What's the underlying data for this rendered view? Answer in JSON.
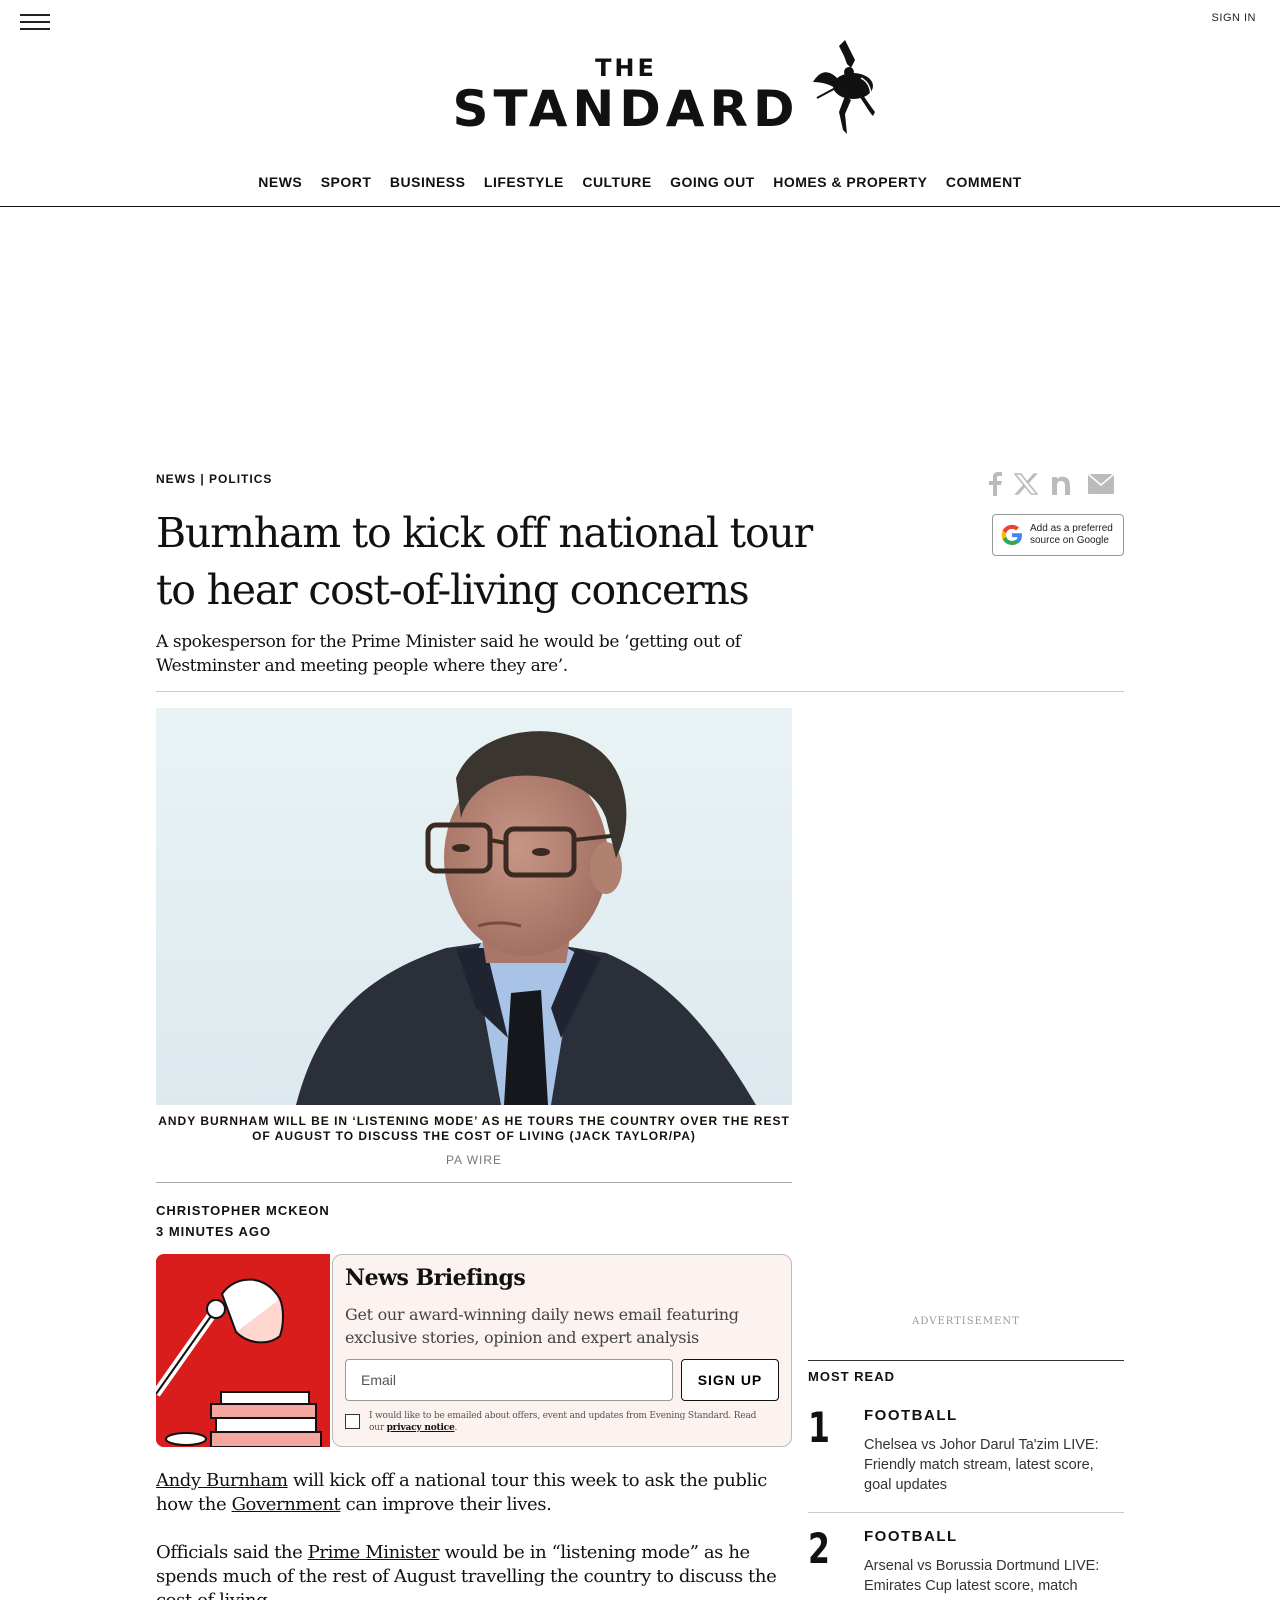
{
  "header": {
    "sign_in": "SIGN IN",
    "logo_the": "THE",
    "logo_main": "STANDARD"
  },
  "nav": [
    "NEWS",
    "SPORT",
    "BUSINESS",
    "LIFESTYLE",
    "CULTURE",
    "GOING OUT",
    "HOMES & PROPERTY",
    "COMMENT"
  ],
  "article": {
    "section": "NEWS",
    "separator": "|",
    "subsection": "POLITICS",
    "headline": "Burnham to kick off national tour to hear cost-of-living concerns",
    "standfirst": "A spokesperson for the Prime Minister said he would be ‘getting out of Westminster and meeting people where they are’.",
    "image_caption": "ANDY BURNHAM WILL BE IN ‘LISTENING MODE’ AS HE TOURS THE COUNTRY OVER THE REST OF AUGUST TO DISCUSS THE COST OF LIVING (JACK TAYLOR/PA)",
    "image_credit": "PA WIRE",
    "author": "CHRISTOPHER MCKEON",
    "published": "3 MINUTES AGO"
  },
  "share": {
    "google_preferred_line1": "Add as a preferred",
    "google_preferred_line2": "source on Google"
  },
  "newsletter": {
    "title": "News Briefings",
    "description": "Get our award-winning daily news email featuring exclusive stories, opinion and expert analysis",
    "email_placeholder": "Email",
    "signup_label": "SIGN UP",
    "consent_text": "I would like to be emailed about offers, event and updates from Evening Standard. Read our",
    "privacy_link": "privacy notice",
    "consent_end": "."
  },
  "body": {
    "p1_link1": "Andy Burnham",
    "p1_text1": " will kick off a national tour this week to ask the public how the ",
    "p1_link2": "Government",
    "p1_text2": " can improve their lives.",
    "p2_text1": "Officials said the ",
    "p2_link1": "Prime Minister",
    "p2_text2": " would be in “listening mode” as he spends much of the rest of August travelling the country to discuss the cost of living."
  },
  "sidebar": {
    "ad_label": "ADVERTISEMENT",
    "most_read_title": "MOST READ",
    "most_read": [
      {
        "rank": "1",
        "category": "FOOTBALL",
        "headline": "Chelsea vs Johor Darul Ta'zim LIVE: Friendly match stream, latest score, goal updates"
      },
      {
        "rank": "2",
        "category": "FOOTBALL",
        "headline": "Arsenal vs Borussia Dortmund LIVE: Emirates Cup latest score, match"
      }
    ]
  },
  "colors": {
    "newsletter_red": "#d81d1c",
    "newsletter_bg": "#fcf2ef"
  }
}
